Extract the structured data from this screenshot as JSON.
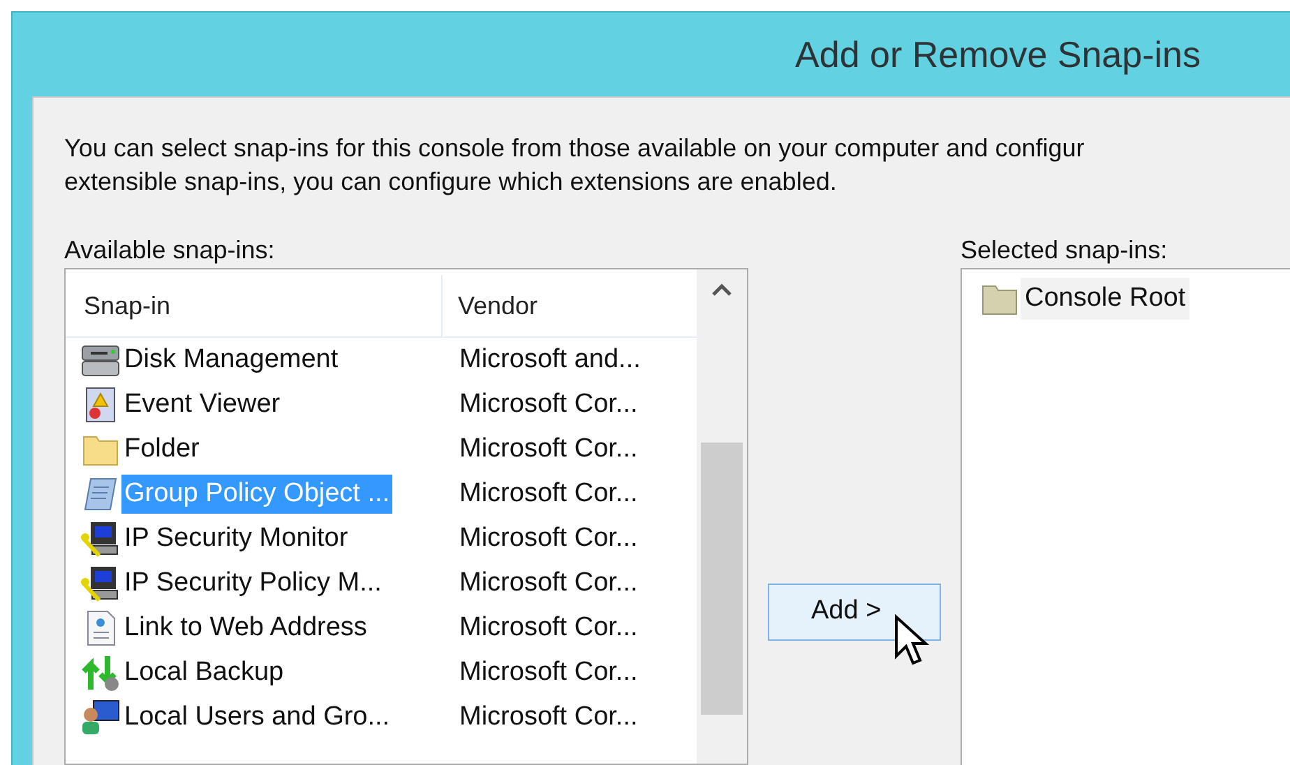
{
  "window": {
    "title": "Add or Remove Snap-ins"
  },
  "description_lines": [
    "You can select snap-ins for this console from those available on your computer and configur",
    "extensible snap-ins, you can configure which extensions are enabled."
  ],
  "available": {
    "label": "Available snap-ins:",
    "columns": [
      "Snap-in",
      "Vendor"
    ],
    "rows": [
      {
        "kind": "disk",
        "name": "Disk Management",
        "vendor": "Microsoft and...",
        "selected": false
      },
      {
        "kind": "event",
        "name": "Event Viewer",
        "vendor": "Microsoft Cor...",
        "selected": false
      },
      {
        "kind": "folder",
        "name": "Folder",
        "vendor": "Microsoft Cor...",
        "selected": false
      },
      {
        "kind": "policy",
        "name": "Group Policy Object ...",
        "vendor": "Microsoft Cor...",
        "selected": true
      },
      {
        "kind": "security",
        "name": "IP Security Monitor",
        "vendor": "Microsoft Cor...",
        "selected": false
      },
      {
        "kind": "security",
        "name": "IP Security Policy M...",
        "vendor": "Microsoft Cor...",
        "selected": false
      },
      {
        "kind": "link",
        "name": "Link to Web Address",
        "vendor": "Microsoft Cor...",
        "selected": false
      },
      {
        "kind": "backup",
        "name": "Local Backup",
        "vendor": "Microsoft Cor...",
        "selected": false
      },
      {
        "kind": "users",
        "name": "Local Users and Gro...",
        "vendor": "Microsoft Cor...",
        "selected": false
      }
    ]
  },
  "add_button": "Add >",
  "selected_snapins": {
    "label": "Selected snap-ins:",
    "items": [
      {
        "kind": "root",
        "name": "Console Root"
      }
    ]
  }
}
